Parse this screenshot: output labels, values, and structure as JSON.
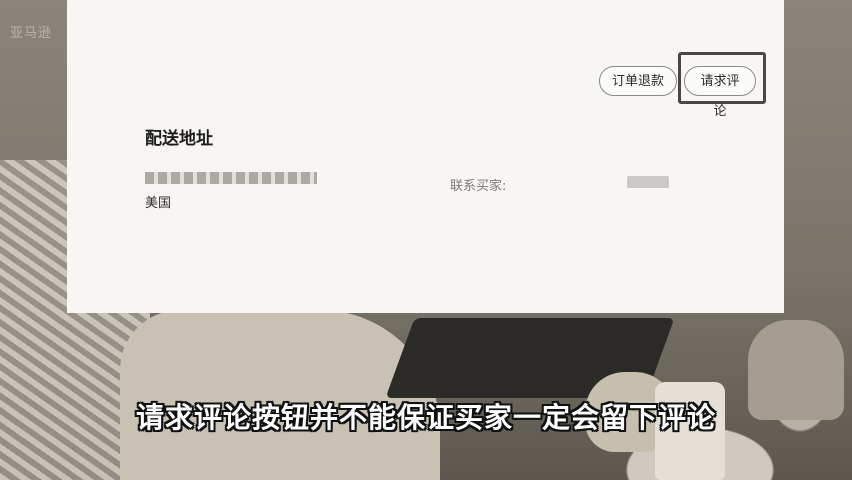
{
  "watermark": "亚马逊",
  "actions": {
    "refund_label": "订单退款",
    "review_label": "请求评论"
  },
  "shipping": {
    "title": "配送地址",
    "country": "美国",
    "contact_label": "联系买家:"
  },
  "subtitle": "请求评论按钮并不能保证买家一定会留下评论"
}
